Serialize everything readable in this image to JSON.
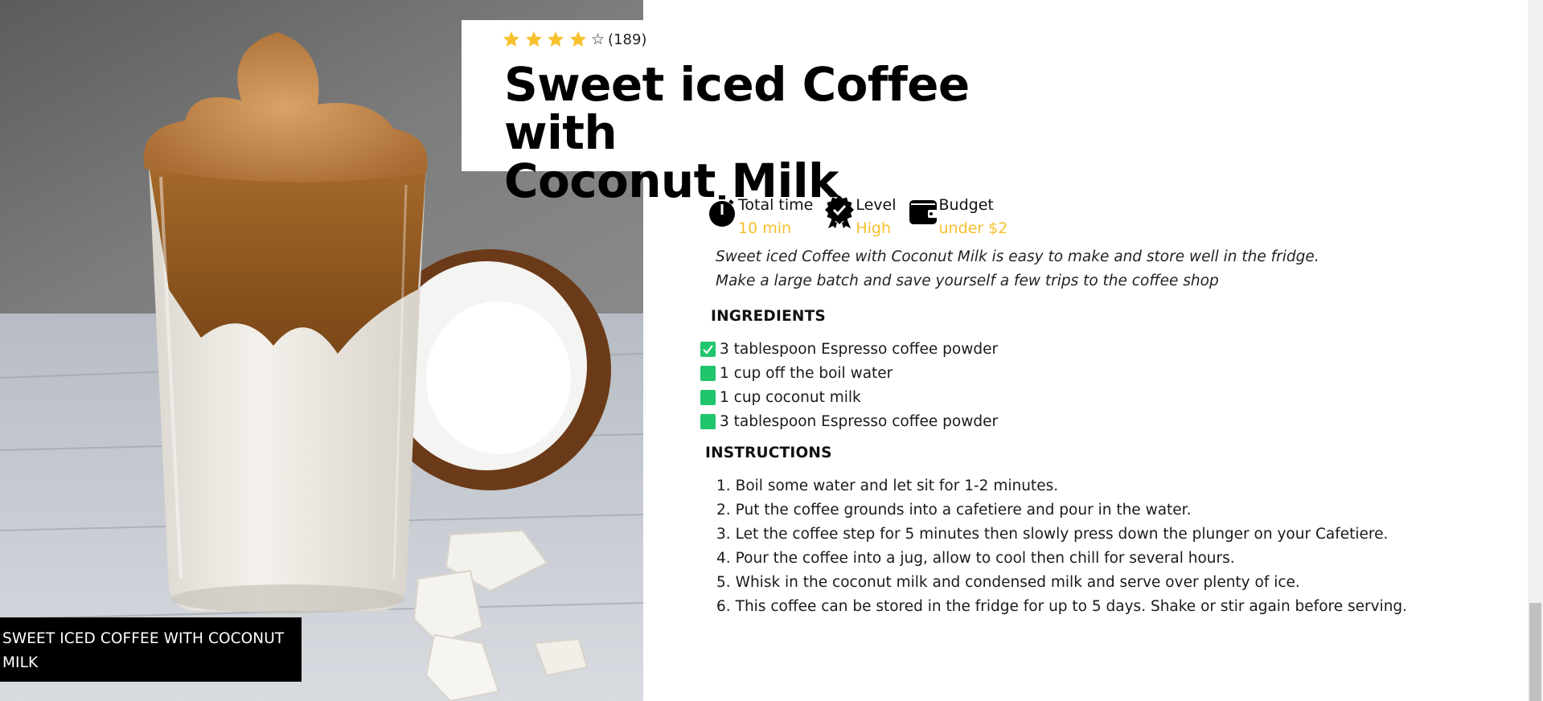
{
  "hero": {
    "caption": "SWEET ICED COFFEE WITH COCONUT MILK"
  },
  "rating": {
    "stars_filled": 4,
    "stars_total": 5,
    "empty_star_glyph": "☆",
    "count": "(189)"
  },
  "recipe": {
    "title_line1": "Sweet iced Coffee with",
    "title_line2": "Coconut Milk",
    "description_line1": "Sweet iced Coffee with Coconut Milk is easy to make and store well in the fridge.",
    "description_line2": "Make a large batch and save yourself a few trips to the coffee shop"
  },
  "meta": [
    {
      "icon": "stopwatch-icon",
      "label": "Total time",
      "value": "10 min"
    },
    {
      "icon": "award-badge-icon",
      "label": "Level",
      "value": "High"
    },
    {
      "icon": "wallet-icon",
      "label": "Budget",
      "value": "under $2"
    }
  ],
  "ingredients": {
    "heading": "INGREDIENTS",
    "items": [
      {
        "text": "3 tablespoon Espresso coffee powder",
        "checked": true
      },
      {
        "text": "1 cup off the boil water",
        "checked": false
      },
      {
        "text": "1 cup coconut milk",
        "checked": false
      },
      {
        "text": "3 tablespoon Espresso coffee powder",
        "checked": false
      }
    ]
  },
  "instructions": {
    "heading": "INSTRUCTIONS",
    "steps": [
      {
        "num": "1.",
        "text": "Boil some water and let sit for 1-2 minutes."
      },
      {
        "num": "2.",
        "text": "Put the coffee grounds into a cafetiere and pour in the water."
      },
      {
        "num": "3.",
        "text": "Let the coffee step for 5 minutes then slowly press down the plunger on your Cafetiere."
      },
      {
        "num": "4.",
        "text": "Pour the coffee into a jug, allow to cool then chill for several hours."
      },
      {
        "num": "5.",
        "text": "Whisk in the coconut milk and condensed milk and serve over plenty of ice."
      },
      {
        "num": "6.",
        "text": "This coffee can be stored in the fridge for up to 5 days. Shake or stir again before serving."
      }
    ]
  },
  "colors": {
    "accent_yellow": "#f6c12d",
    "check_green": "#21c56b",
    "caption_bg": "#000000"
  }
}
